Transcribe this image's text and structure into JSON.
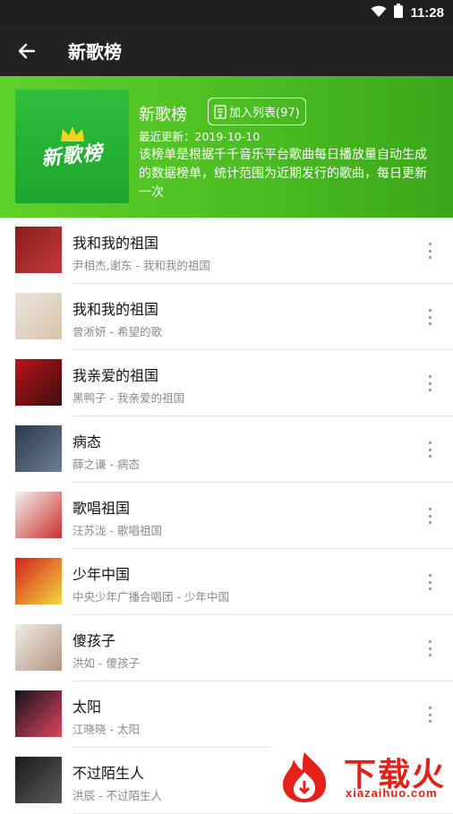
{
  "status_bar": {
    "time": "11:28"
  },
  "app_bar": {
    "title": "新歌榜"
  },
  "header": {
    "cover_text": "新歌榜",
    "name": "新歌榜",
    "add_label": "加入列表(97)",
    "updated": "最近更新：2019-10-10",
    "description": "该榜单是根据千千音乐平台歌曲每日播放量自动生成的数据榜单，统计范围为近期发行的歌曲，每日更新一次"
  },
  "songs": [
    {
      "title": "我和我的祖国",
      "subtitle": "尹相杰,谢东 - 我和我的祖国",
      "thumb_colors": [
        "#8a1c1c",
        "#c23b3b"
      ]
    },
    {
      "title": "我和我的祖国",
      "subtitle": "曾淅妍 - 希望的歌",
      "thumb_colors": [
        "#e9e4df",
        "#d9c3a9"
      ]
    },
    {
      "title": "我亲爱的祖国",
      "subtitle": "黑鸭子 - 我亲爱的祖国",
      "thumb_colors": [
        "#b8141b",
        "#3b0d0d"
      ]
    },
    {
      "title": "病态",
      "subtitle": "薛之谦 - 病态",
      "thumb_colors": [
        "#2c3a4b",
        "#6c7f93"
      ]
    },
    {
      "title": "歌唱祖国",
      "subtitle": "汪苏泷 - 歌唱祖国",
      "thumb_colors": [
        "#f2f2f2",
        "#c9302c"
      ]
    },
    {
      "title": "少年中国",
      "subtitle": "中央少年广播合唱团 - 少年中国",
      "thumb_colors": [
        "#d3211b",
        "#f4d640"
      ]
    },
    {
      "title": "傻孩子",
      "subtitle": "洪如 - 傻孩子",
      "thumb_colors": [
        "#f1ede8",
        "#b39580"
      ]
    },
    {
      "title": "太阳",
      "subtitle": "江晓晓 - 太阳",
      "thumb_colors": [
        "#14121c",
        "#e0455e"
      ]
    },
    {
      "title": "不过陌生人",
      "subtitle": "洪辰 - 不过陌生人",
      "thumb_colors": [
        "#1a1a1a",
        "#5a5a5a"
      ]
    }
  ],
  "watermark": {
    "big": "下载火",
    "small": "xiazaihuo.com"
  }
}
